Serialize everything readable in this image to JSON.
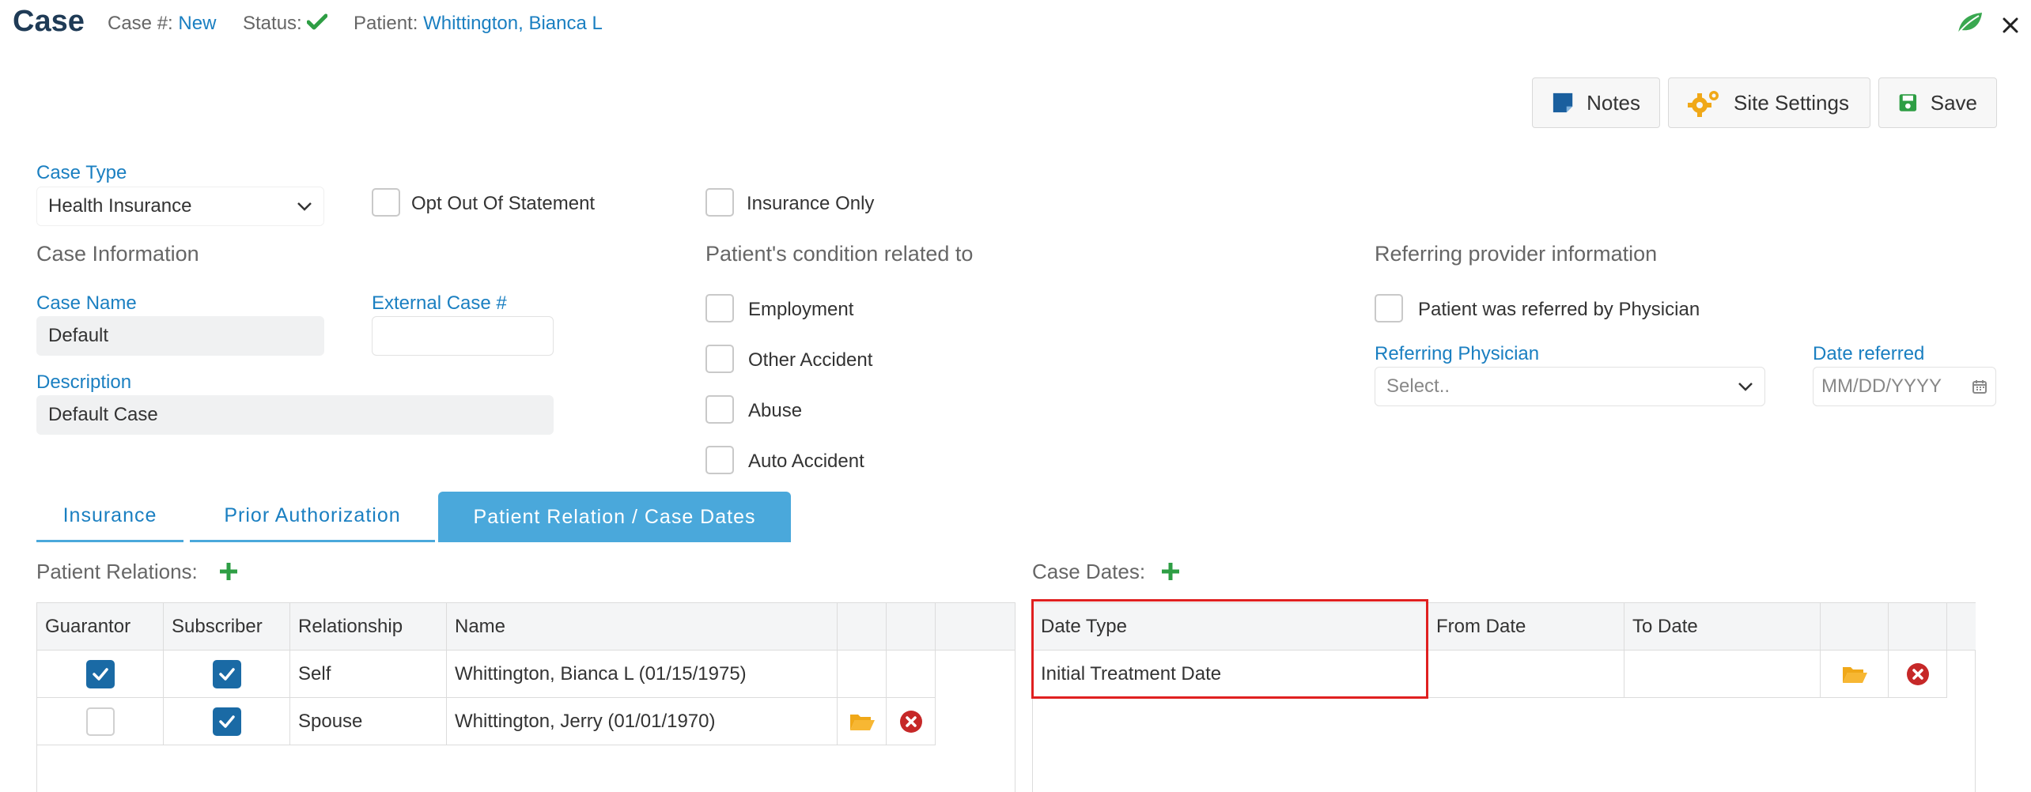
{
  "header": {
    "title": "Case",
    "case_no_label": "Case #:",
    "case_no_value": "New",
    "status_label": "Status:",
    "patient_label": "Patient:",
    "patient_value": "Whittington, Bianca L"
  },
  "toolbar": {
    "notes_label": "Notes",
    "site_settings_label": "Site Settings",
    "save_label": "Save"
  },
  "case_type": {
    "label": "Case Type",
    "value": "Health Insurance"
  },
  "options": {
    "opt_out": "Opt Out Of Statement",
    "insurance_only": "Insurance Only"
  },
  "case_info": {
    "title": "Case Information",
    "case_name_label": "Case Name",
    "case_name_value": "Default",
    "external_label": "External Case #",
    "external_value": "",
    "description_label": "Description",
    "description_value": "Default Case"
  },
  "condition": {
    "title": "Patient's condition related to",
    "items": [
      "Employment",
      "Other Accident",
      "Abuse",
      "Auto Accident"
    ]
  },
  "referring": {
    "title": "Referring provider information",
    "referred_label": "Patient was referred by Physician",
    "physician_label": "Referring Physician",
    "physician_placeholder": "Select..",
    "date_label": "Date referred",
    "date_placeholder": "MM/DD/YYYY"
  },
  "tabs": [
    {
      "label": "Insurance",
      "active": false
    },
    {
      "label": "Prior Authorization",
      "active": false
    },
    {
      "label": "Patient Relation / Case Dates",
      "active": true
    }
  ],
  "relations": {
    "title": "Patient Relations:",
    "columns": [
      "Guarantor",
      "Subscriber",
      "Relationship",
      "Name"
    ],
    "rows": [
      {
        "guarantor": true,
        "subscriber": true,
        "relationship": "Self",
        "name": "Whittington, Bianca L (01/15/1975)"
      },
      {
        "guarantor": false,
        "subscriber": true,
        "relationship": "Spouse",
        "name": "Whittington, Jerry (01/01/1970)"
      }
    ]
  },
  "case_dates": {
    "title": "Case Dates:",
    "columns": [
      "Date Type",
      "From Date",
      "To Date"
    ],
    "rows": [
      {
        "date_type": "Initial Treatment Date",
        "from": "",
        "to": ""
      }
    ]
  },
  "colors": {
    "accent": "#1a7fc1",
    "tab_active": "#4aa8db",
    "success": "#2e9e44",
    "checkbox": "#1a6aa5",
    "danger": "#c62828",
    "folder": "#f0a818",
    "highlight": "#e02020"
  }
}
